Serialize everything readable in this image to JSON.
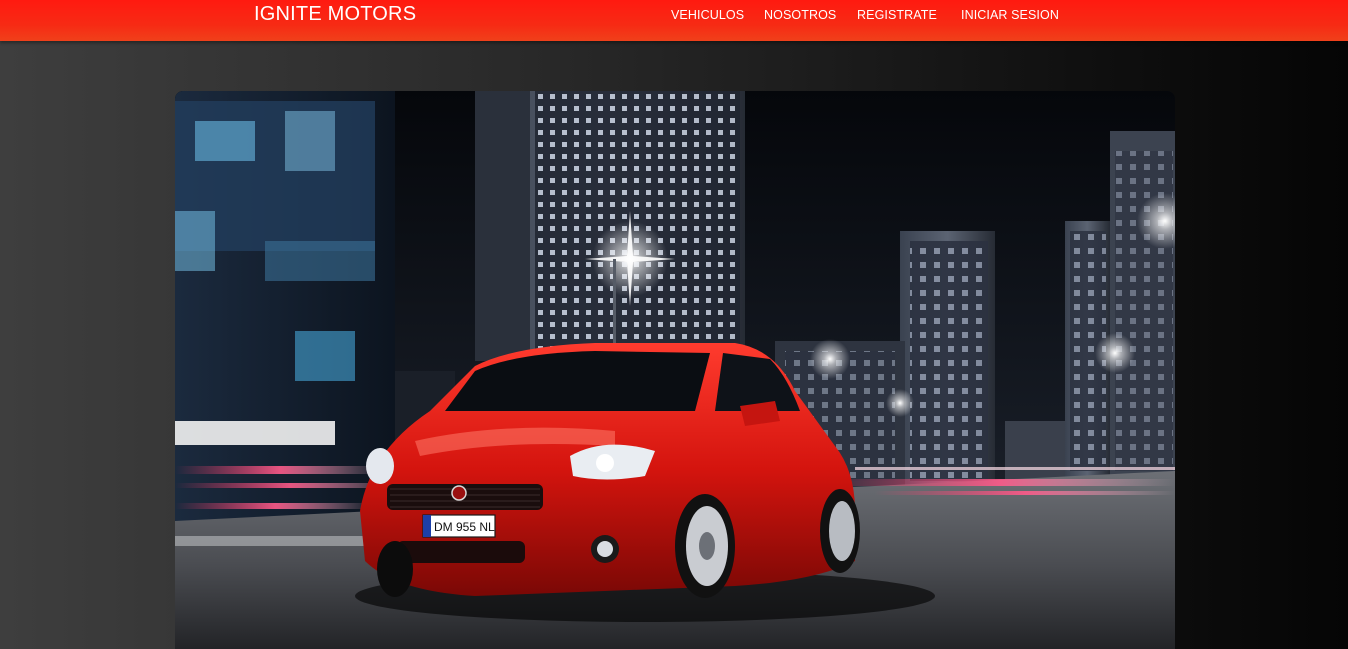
{
  "navbar": {
    "brand": "IGNITE MOTORS",
    "links": [
      {
        "label": "VEHICULOS"
      },
      {
        "label": "NOSOTROS"
      },
      {
        "label": "REGISTRATE"
      },
      {
        "label": "INICIAR SESION"
      }
    ],
    "accent_color": "#ff1a10"
  },
  "hero": {
    "license_plate": "DM 955 NL"
  }
}
